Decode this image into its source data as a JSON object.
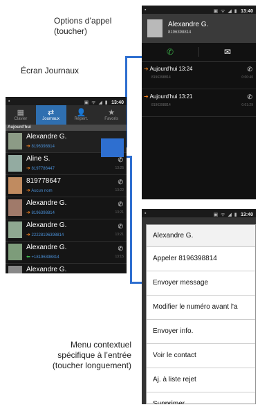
{
  "captions": {
    "options_appel": "Options d’appel (toucher)",
    "ecran_journaux": "Écran Journaux",
    "menu_contextuel": "Menu contextuel spécifique à l’entrée (toucher longuement)"
  },
  "status": {
    "time": "13:40",
    "icons": "▣ ᯤ ◢ ▮"
  },
  "logs": {
    "tabs": [
      {
        "label": "Clavier",
        "glyph": "▦"
      },
      {
        "label": "Journaux",
        "glyph": "⇄"
      },
      {
        "label": "Répert.",
        "glyph": "👤"
      },
      {
        "label": "Favoris",
        "glyph": "★"
      }
    ],
    "section": "Aujourd’hui",
    "rows": [
      {
        "name": "Alexandre G.",
        "num": "8196398814",
        "dir": "➔",
        "time": "",
        "avatar": "#8c9b86"
      },
      {
        "name": "Aline S.",
        "num": "8197786447",
        "dir": "➔",
        "time": "13:25",
        "avatar": "#93aba1"
      },
      {
        "name": "819778647",
        "num": "Aucun nom",
        "dir": "➔",
        "time": "13:22",
        "avatar": "#c08b60"
      },
      {
        "name": "Alexandre G.",
        "num": "8196398814",
        "dir": "➔",
        "time": "13:21",
        "avatar": "#a07a6a"
      },
      {
        "name": "Alexandre G.",
        "num": "22228196398814",
        "dir": "➔",
        "time": "13:21",
        "avatar": "#8fa891"
      },
      {
        "name": "Alexandre G.",
        "num": "+18196398814",
        "dir": "⬅",
        "time": "13:15",
        "avatar": "#7d9c7a"
      },
      {
        "name": "Alexandre G.",
        "num": "",
        "dir": "",
        "time": "",
        "avatar": "#888"
      }
    ]
  },
  "detail": {
    "name": "Alexandre G.",
    "number": "8196398814",
    "call_icon": "✆",
    "msg_icon": "✉",
    "entries": [
      {
        "time": "Aujourd'hui 13:24",
        "num": "8196398814",
        "dur": "0:00:40"
      },
      {
        "time": "Aujourd'hui 13:21",
        "num": "8196398814",
        "dur": "0:01:29"
      }
    ]
  },
  "menu": {
    "title": "Alexandre G.",
    "items": [
      "Appeler 8196398814",
      "Envoyer message",
      "Modifier le numéro avant l'a",
      "Envoyer info.",
      "Voir le contact",
      "Aj. à liste rejet",
      "Supprimer"
    ]
  }
}
